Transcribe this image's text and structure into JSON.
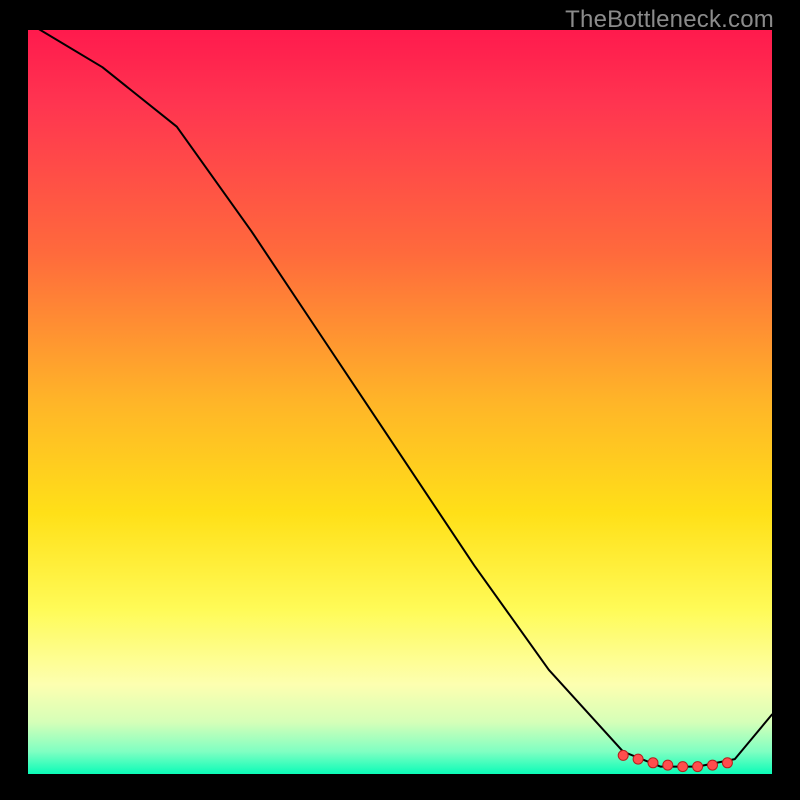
{
  "watermark": "TheBottleneck.com",
  "colors": {
    "line": "#000000",
    "marker_fill": "#ff4d4d",
    "marker_stroke": "#b81d1d"
  },
  "chart_data": {
    "type": "line",
    "title": "",
    "xlabel": "",
    "ylabel": "",
    "xlim": [
      0,
      100
    ],
    "ylim": [
      0,
      100
    ],
    "x": [
      0,
      10,
      20,
      30,
      40,
      50,
      60,
      70,
      80,
      85,
      90,
      95,
      100
    ],
    "values": [
      101,
      95,
      87,
      73,
      58,
      43,
      28,
      14,
      3,
      1,
      1,
      2,
      8
    ],
    "markers_x": [
      80,
      82,
      84,
      86,
      88,
      90,
      92,
      94
    ],
    "markers_y": [
      2.5,
      2.0,
      1.5,
      1.2,
      1.0,
      1.0,
      1.2,
      1.5
    ]
  }
}
